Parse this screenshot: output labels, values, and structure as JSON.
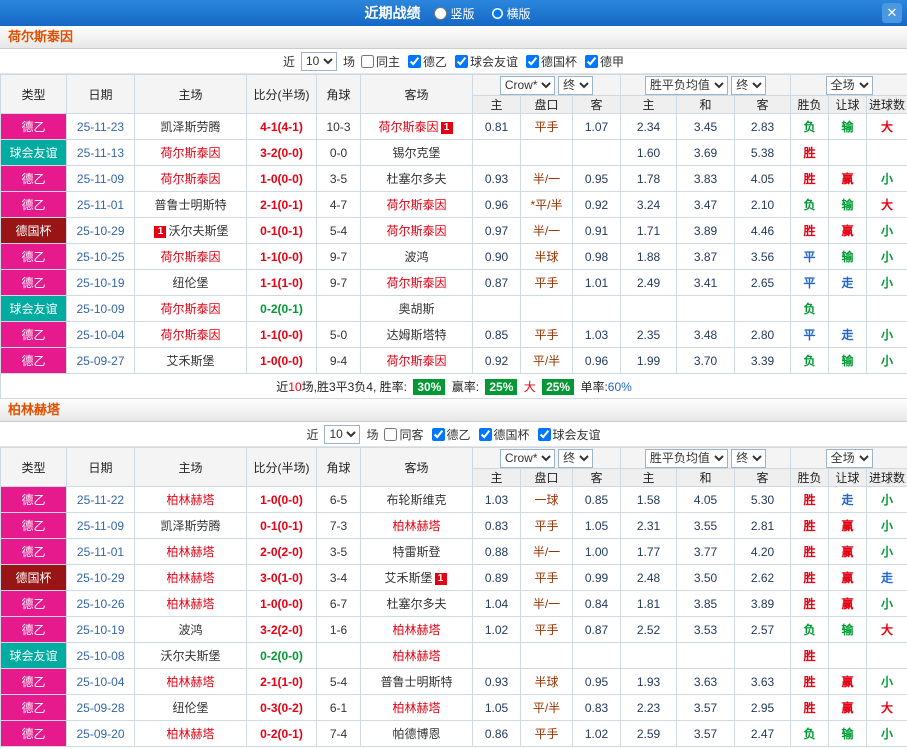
{
  "header": {
    "title": "近期战绩",
    "vertical_label": "竖版",
    "horizontal_label": "横版",
    "close": "✕"
  },
  "filter": {
    "near": "近",
    "count": "10",
    "matches": "场"
  },
  "table_head": {
    "type": "类型",
    "date": "日期",
    "home": "主场",
    "score": "比分(半场)",
    "corner": "角球",
    "away": "客场",
    "bookmaker": "Crow*",
    "stage": "终",
    "avg": "胜平负均值",
    "scope": "全场",
    "sub": [
      "主",
      "盘口",
      "客",
      "主",
      "和",
      "客",
      "胜负",
      "让球",
      "进球数"
    ]
  },
  "colors": {
    "topbar_blue": "#1873d2",
    "league_de2": "#e61a8d",
    "league_friendly": "#00ab9f",
    "league_cup": "#991414",
    "win_red": "#e60012",
    "lose_green": "#009933",
    "draw_blue": "#2266cc",
    "section_title": "#e05000"
  },
  "sections": [
    {
      "team": "荷尔斯泰因",
      "filters": [
        {
          "label": "同主",
          "checked": false
        },
        {
          "label": "德乙",
          "checked": true
        },
        {
          "label": "球会友谊",
          "checked": true
        },
        {
          "label": "德国杯",
          "checked": true
        },
        {
          "label": "德甲",
          "checked": true
        }
      ],
      "rows": [
        {
          "league": "德乙",
          "lc": "de2",
          "date": "25-11-23",
          "home": {
            "n": "凯泽斯劳腾"
          },
          "score": "4-1(4-1)",
          "sc": "r",
          "corner": "10-3",
          "away": {
            "n": "荷尔斯泰因",
            "red": 1,
            "badge": "1",
            "bp": "right"
          },
          "crow": [
            "0.81",
            "平手",
            "1.07"
          ],
          "avg": [
            "2.34",
            "3.45",
            "2.83"
          ],
          "res": [
            [
              "负",
              "g"
            ],
            [
              "输",
              "g"
            ],
            [
              "大",
              "r"
            ]
          ]
        },
        {
          "league": "球会友谊",
          "lc": "fri",
          "date": "25-11-13",
          "home": {
            "n": "荷尔斯泰因",
            "red": 1
          },
          "score": "3-2(0-0)",
          "sc": "r",
          "corner": "0-0",
          "away": {
            "n": "锡尔克堡"
          },
          "crow": [
            "",
            "",
            ""
          ],
          "avg": [
            "1.60",
            "3.69",
            "5.38"
          ],
          "res": [
            [
              "胜",
              "r"
            ],
            [
              "",
              ""
            ],
            [
              "",
              ""
            ]
          ]
        },
        {
          "league": "德乙",
          "lc": "de2",
          "date": "25-11-09",
          "home": {
            "n": "荷尔斯泰因",
            "red": 1
          },
          "score": "1-0(0-0)",
          "sc": "r",
          "corner": "3-5",
          "away": {
            "n": "杜塞尔多夫"
          },
          "crow": [
            "0.93",
            "半/一",
            "0.95"
          ],
          "avg": [
            "1.78",
            "3.83",
            "4.05"
          ],
          "res": [
            [
              "胜",
              "r"
            ],
            [
              "赢",
              "r"
            ],
            [
              "小",
              "g"
            ]
          ]
        },
        {
          "league": "德乙",
          "lc": "de2",
          "date": "25-11-01",
          "home": {
            "n": "普鲁士明斯特"
          },
          "score": "2-1(0-1)",
          "sc": "r",
          "corner": "4-7",
          "away": {
            "n": "荷尔斯泰因",
            "red": 1
          },
          "crow": [
            "0.96",
            "*平/半",
            "0.92"
          ],
          "avg": [
            "3.24",
            "3.47",
            "2.10"
          ],
          "res": [
            [
              "负",
              "g"
            ],
            [
              "输",
              "g"
            ],
            [
              "大",
              "r"
            ]
          ]
        },
        {
          "league": "德国杯",
          "lc": "cup",
          "date": "25-10-29",
          "home": {
            "n": "沃尔夫斯堡",
            "badge": "1",
            "bp": "left"
          },
          "score": "0-1(0-1)",
          "sc": "r",
          "corner": "5-4",
          "away": {
            "n": "荷尔斯泰因",
            "red": 1
          },
          "crow": [
            "0.97",
            "半/一",
            "0.91"
          ],
          "avg": [
            "1.71",
            "3.89",
            "4.46"
          ],
          "res": [
            [
              "胜",
              "r"
            ],
            [
              "赢",
              "r"
            ],
            [
              "小",
              "g"
            ]
          ]
        },
        {
          "league": "德乙",
          "lc": "de2",
          "date": "25-10-25",
          "home": {
            "n": "荷尔斯泰因",
            "red": 1
          },
          "score": "1-1(0-0)",
          "sc": "r",
          "corner": "9-7",
          "away": {
            "n": "波鸿"
          },
          "crow": [
            "0.90",
            "半球",
            "0.98"
          ],
          "avg": [
            "1.88",
            "3.87",
            "3.56"
          ],
          "res": [
            [
              "平",
              "b"
            ],
            [
              "输",
              "g"
            ],
            [
              "小",
              "g"
            ]
          ]
        },
        {
          "league": "德乙",
          "lc": "de2",
          "date": "25-10-19",
          "home": {
            "n": "纽伦堡"
          },
          "score": "1-1(1-0)",
          "sc": "r",
          "corner": "9-7",
          "away": {
            "n": "荷尔斯泰因",
            "red": 1
          },
          "crow": [
            "0.87",
            "平手",
            "1.01"
          ],
          "avg": [
            "2.49",
            "3.41",
            "2.65"
          ],
          "res": [
            [
              "平",
              "b"
            ],
            [
              "走",
              "b"
            ],
            [
              "小",
              "g"
            ]
          ]
        },
        {
          "league": "球会友谊",
          "lc": "fri",
          "date": "25-10-09",
          "home": {
            "n": "荷尔斯泰因",
            "red": 1
          },
          "score": "0-2(0-1)",
          "sc": "g",
          "corner": "",
          "away": {
            "n": "奥胡斯"
          },
          "crow": [
            "",
            "",
            ""
          ],
          "avg": [
            "",
            "",
            ""
          ],
          "res": [
            [
              "负",
              "g"
            ],
            [
              "",
              ""
            ],
            [
              "",
              ""
            ]
          ]
        },
        {
          "league": "德乙",
          "lc": "de2",
          "date": "25-10-04",
          "home": {
            "n": "荷尔斯泰因",
            "red": 1
          },
          "score": "1-1(0-0)",
          "sc": "r",
          "corner": "5-0",
          "away": {
            "n": "达姆斯塔特"
          },
          "crow": [
            "0.85",
            "平手",
            "1.03"
          ],
          "avg": [
            "2.35",
            "3.48",
            "2.80"
          ],
          "res": [
            [
              "平",
              "b"
            ],
            [
              "走",
              "b"
            ],
            [
              "小",
              "g"
            ]
          ]
        },
        {
          "league": "德乙",
          "lc": "de2",
          "date": "25-09-27",
          "home": {
            "n": "艾禾斯堡"
          },
          "score": "1-0(0-0)",
          "sc": "r",
          "corner": "9-4",
          "away": {
            "n": "荷尔斯泰因",
            "red": 1
          },
          "crow": [
            "0.92",
            "平/半",
            "0.96"
          ],
          "avg": [
            "1.99",
            "3.70",
            "3.39"
          ],
          "res": [
            [
              "负",
              "g"
            ],
            [
              "输",
              "g"
            ],
            [
              "小",
              "g"
            ]
          ]
        }
      ],
      "summary": {
        "parts": [
          {
            "t": "近",
            "c": "k"
          },
          {
            "t": "10",
            "c": "r"
          },
          {
            "t": "场,胜3平3负4, 胜率: ",
            "c": "k"
          },
          {
            "t": "30%",
            "c": "box"
          },
          {
            "t": " 赢率: ",
            "c": "k"
          },
          {
            "t": "25%",
            "c": "box"
          },
          {
            "t": " 大 ",
            "c": "r"
          },
          {
            "t": "25%",
            "c": "box"
          },
          {
            "t": " 单率:",
            "c": "k"
          },
          {
            "t": "60%",
            "c": "b"
          }
        ]
      }
    },
    {
      "team": "柏林赫塔",
      "filters": [
        {
          "label": "同客",
          "checked": false
        },
        {
          "label": "德乙",
          "checked": true
        },
        {
          "label": "德国杯",
          "checked": true
        },
        {
          "label": "球会友谊",
          "checked": true
        }
      ],
      "rows": [
        {
          "league": "德乙",
          "lc": "de2",
          "date": "25-11-22",
          "home": {
            "n": "柏林赫塔",
            "red": 1
          },
          "score": "1-0(0-0)",
          "sc": "r",
          "corner": "6-5",
          "away": {
            "n": "布轮斯维克"
          },
          "crow": [
            "1.03",
            "一球",
            "0.85"
          ],
          "avg": [
            "1.58",
            "4.05",
            "5.30"
          ],
          "res": [
            [
              "胜",
              "r"
            ],
            [
              "走",
              "b"
            ],
            [
              "小",
              "g"
            ]
          ]
        },
        {
          "league": "德乙",
          "lc": "de2",
          "date": "25-11-09",
          "home": {
            "n": "凯泽斯劳腾"
          },
          "score": "0-1(0-1)",
          "sc": "r",
          "corner": "7-3",
          "away": {
            "n": "柏林赫塔",
            "red": 1
          },
          "crow": [
            "0.83",
            "平手",
            "1.05"
          ],
          "avg": [
            "2.31",
            "3.55",
            "2.81"
          ],
          "res": [
            [
              "胜",
              "r"
            ],
            [
              "赢",
              "r"
            ],
            [
              "小",
              "g"
            ]
          ]
        },
        {
          "league": "德乙",
          "lc": "de2",
          "date": "25-11-01",
          "home": {
            "n": "柏林赫塔",
            "red": 1
          },
          "score": "2-0(2-0)",
          "sc": "r",
          "corner": "3-5",
          "away": {
            "n": "特雷斯登"
          },
          "crow": [
            "0.88",
            "半/一",
            "1.00"
          ],
          "avg": [
            "1.77",
            "3.77",
            "4.20"
          ],
          "res": [
            [
              "胜",
              "r"
            ],
            [
              "赢",
              "r"
            ],
            [
              "小",
              "g"
            ]
          ]
        },
        {
          "league": "德国杯",
          "lc": "cup",
          "date": "25-10-29",
          "home": {
            "n": "柏林赫塔",
            "red": 1
          },
          "score": "3-0(1-0)",
          "sc": "r",
          "corner": "3-4",
          "away": {
            "n": "艾禾斯堡",
            "badge": "1",
            "bp": "right"
          },
          "crow": [
            "0.89",
            "平手",
            "0.99"
          ],
          "avg": [
            "2.48",
            "3.50",
            "2.62"
          ],
          "res": [
            [
              "胜",
              "r"
            ],
            [
              "赢",
              "r"
            ],
            [
              "走",
              "b"
            ]
          ]
        },
        {
          "league": "德乙",
          "lc": "de2",
          "date": "25-10-26",
          "home": {
            "n": "柏林赫塔",
            "red": 1
          },
          "score": "1-0(0-0)",
          "sc": "r",
          "corner": "6-7",
          "away": {
            "n": "杜塞尔多夫"
          },
          "crow": [
            "1.04",
            "半/一",
            "0.84"
          ],
          "avg": [
            "1.81",
            "3.85",
            "3.89"
          ],
          "res": [
            [
              "胜",
              "r"
            ],
            [
              "赢",
              "r"
            ],
            [
              "小",
              "g"
            ]
          ]
        },
        {
          "league": "德乙",
          "lc": "de2",
          "date": "25-10-19",
          "home": {
            "n": "波鸿"
          },
          "score": "3-2(2-0)",
          "sc": "r",
          "corner": "1-6",
          "away": {
            "n": "柏林赫塔",
            "red": 1
          },
          "crow": [
            "1.02",
            "平手",
            "0.87"
          ],
          "avg": [
            "2.52",
            "3.53",
            "2.57"
          ],
          "res": [
            [
              "负",
              "g"
            ],
            [
              "输",
              "g"
            ],
            [
              "大",
              "r"
            ]
          ]
        },
        {
          "league": "球会友谊",
          "lc": "fri",
          "date": "25-10-08",
          "home": {
            "n": "沃尔夫斯堡"
          },
          "score": "0-2(0-0)",
          "sc": "g",
          "corner": "",
          "away": {
            "n": "柏林赫塔",
            "red": 1
          },
          "crow": [
            "",
            "",
            ""
          ],
          "avg": [
            "",
            "",
            ""
          ],
          "res": [
            [
              "胜",
              "r"
            ],
            [
              "",
              ""
            ],
            [
              "",
              ""
            ]
          ]
        },
        {
          "league": "德乙",
          "lc": "de2",
          "date": "25-10-04",
          "home": {
            "n": "柏林赫塔",
            "red": 1
          },
          "score": "2-1(1-0)",
          "sc": "r",
          "corner": "5-4",
          "away": {
            "n": "普鲁士明斯特"
          },
          "crow": [
            "0.93",
            "半球",
            "0.95"
          ],
          "avg": [
            "1.93",
            "3.63",
            "3.63"
          ],
          "res": [
            [
              "胜",
              "r"
            ],
            [
              "赢",
              "r"
            ],
            [
              "小",
              "g"
            ]
          ]
        },
        {
          "league": "德乙",
          "lc": "de2",
          "date": "25-09-28",
          "home": {
            "n": "纽伦堡"
          },
          "score": "0-3(0-2)",
          "sc": "r",
          "corner": "6-1",
          "away": {
            "n": "柏林赫塔",
            "red": 1
          },
          "crow": [
            "1.05",
            "平/半",
            "0.83"
          ],
          "avg": [
            "2.23",
            "3.57",
            "2.95"
          ],
          "res": [
            [
              "胜",
              "r"
            ],
            [
              "赢",
              "r"
            ],
            [
              "大",
              "r"
            ]
          ]
        },
        {
          "league": "德乙",
          "lc": "de2",
          "date": "25-09-20",
          "home": {
            "n": "柏林赫塔",
            "red": 1
          },
          "score": "0-2(0-1)",
          "sc": "r",
          "corner": "7-4",
          "away": {
            "n": "帕德博恩"
          },
          "crow": [
            "0.86",
            "平手",
            "1.02"
          ],
          "avg": [
            "2.59",
            "3.57",
            "2.47"
          ],
          "res": [
            [
              "负",
              "g"
            ],
            [
              "输",
              "g"
            ],
            [
              "小",
              "g"
            ]
          ]
        }
      ]
    }
  ]
}
